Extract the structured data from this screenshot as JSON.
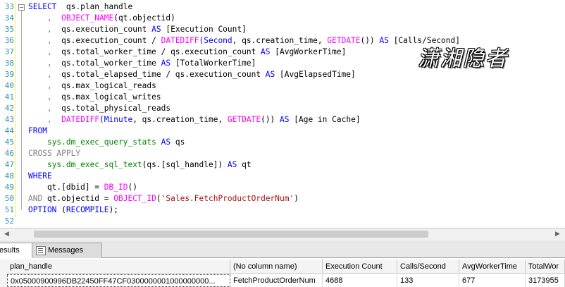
{
  "editor": {
    "lines": [
      {
        "n": "33",
        "parts": [
          [
            "kw",
            "SELECT"
          ],
          [
            "",
            "  qs.plan_handle"
          ]
        ]
      },
      {
        "n": "34",
        "parts": [
          [
            "gray",
            "    ,  "
          ],
          [
            "fn",
            "OBJECT_NAME"
          ],
          [
            "",
            "(qt.objectid)"
          ]
        ]
      },
      {
        "n": "35",
        "parts": [
          [
            "gray",
            "    ,  "
          ],
          [
            "",
            "qs.execution_count "
          ],
          [
            "kw",
            "AS"
          ],
          [
            "",
            " [Execution Count]"
          ]
        ]
      },
      {
        "n": "36",
        "parts": [
          [
            "gray",
            "    ,  "
          ],
          [
            "",
            "qs.execution_count / "
          ],
          [
            "fn",
            "DATEDIFF"
          ],
          [
            "kw",
            "(Second"
          ],
          [
            "",
            ", qs.creation_time, "
          ],
          [
            "fn",
            "GETDATE"
          ],
          [
            "",
            "()) "
          ],
          [
            "kw",
            "AS"
          ],
          [
            "",
            " [Calls/Second]"
          ]
        ]
      },
      {
        "n": "37",
        "parts": [
          [
            "gray",
            "    ,  "
          ],
          [
            "",
            "qs.total_worker_time / qs.execution_count "
          ],
          [
            "kw",
            "AS"
          ],
          [
            "",
            " [AvgWorkerTime]"
          ]
        ]
      },
      {
        "n": "38",
        "parts": [
          [
            "gray",
            "    ,  "
          ],
          [
            "",
            "qs.total_worker_time "
          ],
          [
            "kw",
            "AS"
          ],
          [
            "",
            " [TotalWorkerTime]"
          ]
        ]
      },
      {
        "n": "39",
        "parts": [
          [
            "gray",
            "    ,  "
          ],
          [
            "",
            "qs.total_elapsed_time / qs.execution_count "
          ],
          [
            "kw",
            "AS"
          ],
          [
            "",
            " [AvgElapsedTime]"
          ]
        ]
      },
      {
        "n": "40",
        "parts": [
          [
            "gray",
            "    ,  "
          ],
          [
            "",
            "qs.max_logical_reads"
          ]
        ]
      },
      {
        "n": "41",
        "parts": [
          [
            "gray",
            "    ,  "
          ],
          [
            "",
            "qs.max_logical_writes"
          ]
        ]
      },
      {
        "n": "42",
        "parts": [
          [
            "gray",
            "    ,  "
          ],
          [
            "",
            "qs.total_physical_reads"
          ]
        ]
      },
      {
        "n": "43",
        "parts": [
          [
            "gray",
            "    ,  "
          ],
          [
            "fn",
            "DATEDIFF"
          ],
          [
            "kw",
            "(Minute"
          ],
          [
            "",
            ", qs.creation_time, "
          ],
          [
            "fn",
            "GETDATE"
          ],
          [
            "",
            "()) "
          ],
          [
            "kw",
            "AS"
          ],
          [
            "",
            " [Age in Cache]"
          ]
        ]
      },
      {
        "n": "44",
        "parts": [
          [
            "kw",
            "FROM"
          ]
        ]
      },
      {
        "n": "45",
        "parts": [
          [
            "",
            "    "
          ],
          [
            "sys",
            "sys.dm_exec_query_stats"
          ],
          [
            "",
            " "
          ],
          [
            "kw",
            "AS"
          ],
          [
            "",
            " qs"
          ]
        ]
      },
      {
        "n": "46",
        "parts": [
          [
            "gray",
            "CROSS APPLY"
          ]
        ]
      },
      {
        "n": "47",
        "parts": [
          [
            "",
            "    "
          ],
          [
            "sys",
            "sys.dm_exec_sql_text"
          ],
          [
            "",
            "(qs.[sql_handle]) "
          ],
          [
            "kw",
            "AS"
          ],
          [
            "",
            " qt"
          ]
        ]
      },
      {
        "n": "48",
        "parts": [
          [
            "kw",
            "WHERE"
          ]
        ]
      },
      {
        "n": "49",
        "parts": [
          [
            "",
            "    qt.[dbid] = "
          ],
          [
            "fn",
            "DB_ID"
          ],
          [
            "",
            "()"
          ]
        ]
      },
      {
        "n": "50",
        "parts": [
          [
            "gray",
            "AND"
          ],
          [
            "",
            " qt.objectid = "
          ],
          [
            "fn",
            "OBJECT_ID"
          ],
          [
            "",
            "("
          ],
          [
            "str",
            "'Sales.FetchProductOrderNum'"
          ],
          [
            "",
            ")"
          ]
        ]
      },
      {
        "n": "51",
        "parts": [
          [
            "kw",
            "OPTION"
          ],
          [
            "",
            " ("
          ],
          [
            "kw",
            "RECOMPILE"
          ],
          [
            "",
            ");"
          ]
        ]
      },
      {
        "n": "52",
        "parts": []
      }
    ]
  },
  "watermark": "潇湘隐者",
  "tabs": {
    "results": "esults",
    "messages": "Messages"
  },
  "grid": {
    "columns": [
      "plan_handle",
      "(No column name)",
      "Execution Count",
      "Calls/Second",
      "AvgWorkerTime",
      "TotalWor"
    ],
    "row": [
      "0x05000900996DB22450FF47CF0300000001000000000...",
      "FetchProductOrderNum",
      "4688",
      "133",
      "677",
      "3173955"
    ]
  }
}
